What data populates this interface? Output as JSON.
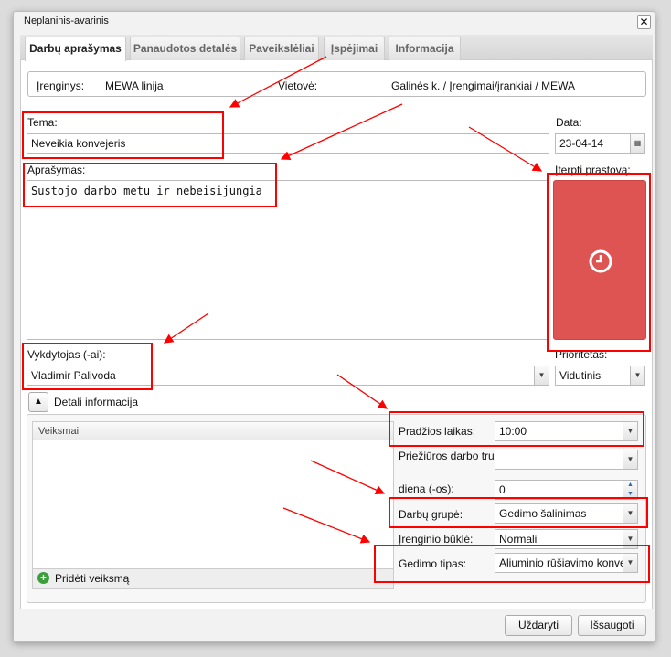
{
  "dialog": {
    "title": "Neplaninis-avarinis"
  },
  "tabs": [
    {
      "label": "Darbų aprašymas"
    },
    {
      "label": "Panaudotos detalės"
    },
    {
      "label": "Paveikslėliai"
    },
    {
      "label": "Įspėjimai"
    },
    {
      "label": "Informacija"
    }
  ],
  "info": {
    "device_label": "Įrenginys:",
    "device_value": "MEWA linija",
    "location_label": "Vietovė:",
    "location_value": "Galinės k. / Įrengimai/įrankiai / MEWA"
  },
  "form": {
    "tema_label": "Tema:",
    "tema_value": "Neveikia konvejeris",
    "data_label": "Data:",
    "data_value": "23-04-14",
    "aprasymas_label": "Aprašymas:",
    "aprasymas_value": "Sustojo darbo metu ir nebeisijungia",
    "downtime_label": "Įterpti prastovą:",
    "vykdytojas_label": "Vykdytojas (-ai):",
    "vykdytojas_value": "Vladimir Palivoda",
    "prioritetas_label": "Prioritetas:",
    "prioritetas_value": "Vidutinis",
    "details_label": "Detali informacija",
    "veiksmai_header": "Veiksmai",
    "add_action": "Pridėti veiksmą",
    "pradzios_label": "Pradžios laikas:",
    "pradzios_value": "10:00",
    "trukme_label": "Priežiūros darbo trukmė:",
    "trukme_value": "",
    "diena_label": "diena (-os):",
    "diena_value": "0",
    "grupe_label": "Darbų grupė:",
    "grupe_value": "Gedimo šalinimas",
    "bukle_label": "Įrenginio būklė:",
    "bukle_value": "Normali",
    "tipas_label": "Gedimo tipas:",
    "tipas_value": "Aliuminio rūšiavimo konveje"
  },
  "buttons": {
    "close": "Uždaryti",
    "save": "Išsaugoti"
  },
  "colors": {
    "downtime_button": "#de5452",
    "annotation": "#ff0000"
  }
}
